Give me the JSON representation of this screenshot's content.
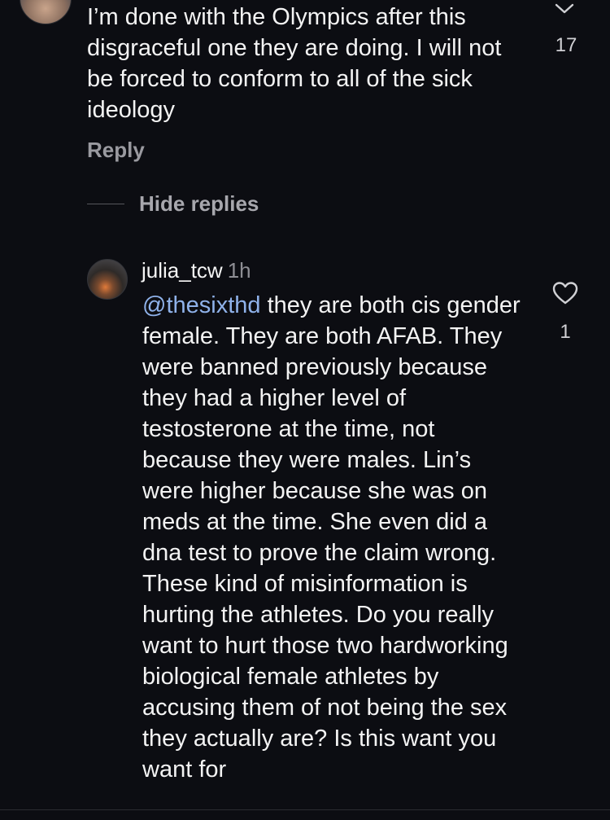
{
  "top_comment": {
    "text": "I’m done with the Olympics after this disgraceful one they are doing. I will not be forced to conform to all of the sick ideology",
    "like_count": "17",
    "reply_label": "Reply",
    "hide_replies_label": "Hide replies",
    "avatar_icon": "user-avatar",
    "collapse_icon": "chevron-down-icon"
  },
  "reply": {
    "username": "julia_tcw",
    "time": "1h",
    "mention": "@thesixthd",
    "text": " they are both cis gender female. They are both AFAB. They were banned previously because they had a higher level of testosterone at the time, not because they were males. Lin’s were higher because she was on meds at the time. She even did a dna test to prove the claim wrong. These kind of misinformation is hurting the athletes. Do you really want to hurt those two hardworking biological female athletes by accusing them of not being the sex they actually are? Is this want you want for",
    "like_count": "1",
    "like_icon": "heart-icon",
    "avatar_icon": "user-avatar"
  },
  "colors": {
    "background": "#0c0d12",
    "text": "#f3f3f3",
    "muted": "#9a9aa0",
    "mention": "#8fb2ea"
  }
}
